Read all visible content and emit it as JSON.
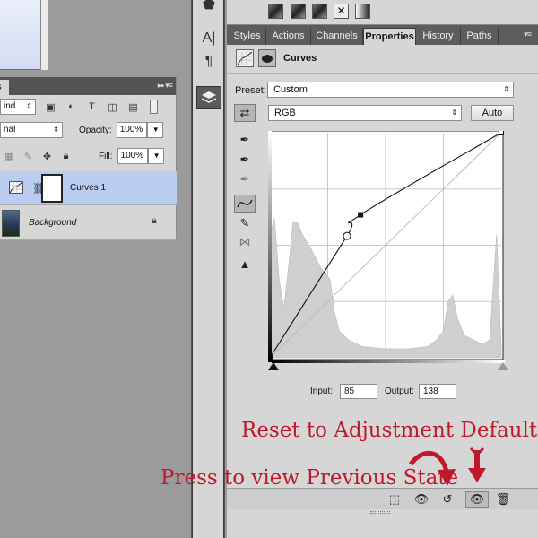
{
  "layers_panel": {
    "tab_label": "s",
    "blend_filter_value": "ind",
    "blend_mode_value": "nal",
    "opacity_label": "Opacity:",
    "opacity_value": "100%",
    "fill_label": "Fill:",
    "fill_value": "100%",
    "layers": [
      {
        "name": "Curves 1",
        "selected": true
      },
      {
        "name": "Background",
        "locked": true
      }
    ]
  },
  "properties_panel": {
    "tabs": [
      "Styles",
      "Actions",
      "Channels",
      "Properties",
      "History",
      "Paths"
    ],
    "active_tab": "Properties",
    "adjustment_title": "Curves",
    "preset_label": "Preset:",
    "preset_value": "Custom",
    "channel_value": "RGB",
    "auto_button": "Auto",
    "input_label": "Input:",
    "input_value": "85",
    "output_label": "Output:",
    "output_value": "138",
    "curve_points": [
      {
        "input": 0,
        "output": 0
      },
      {
        "input": 85,
        "output": 138
      },
      {
        "input": 100,
        "output": 162
      },
      {
        "input": 255,
        "output": 255
      }
    ],
    "selected_point": {
      "input": 85,
      "output": 138
    }
  },
  "annotations": {
    "reset": "Reset to Adjustment Defaults",
    "previous_state": "Press to view Previous State"
  },
  "colors": {
    "annotation": "#c0182b",
    "selection": "#b8cdf0",
    "panel": "#d6d6d6"
  }
}
